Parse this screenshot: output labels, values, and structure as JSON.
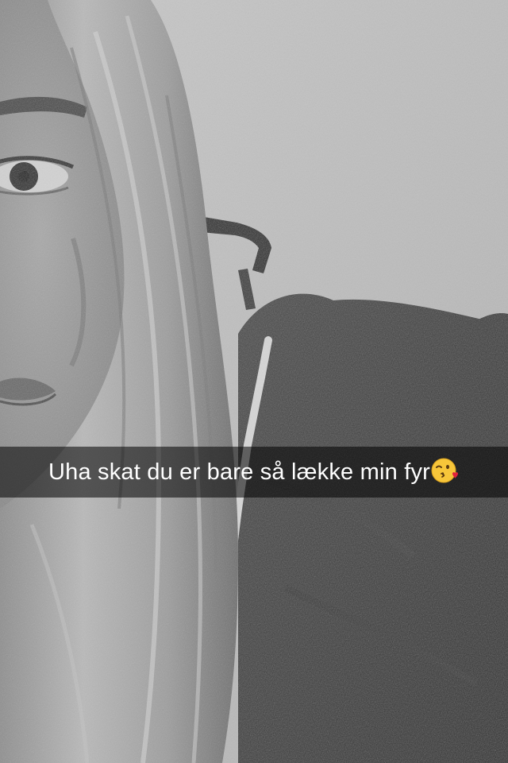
{
  "snap": {
    "caption": {
      "text": "Uha skat du er bare så lække min fyr",
      "emoji": "face-throwing-a-kiss"
    }
  },
  "colors": {
    "caption_bar": "#000000",
    "caption_text": "#ffffff",
    "emoji_face": "#f7c63a",
    "emoji_heart": "#e0233c"
  }
}
